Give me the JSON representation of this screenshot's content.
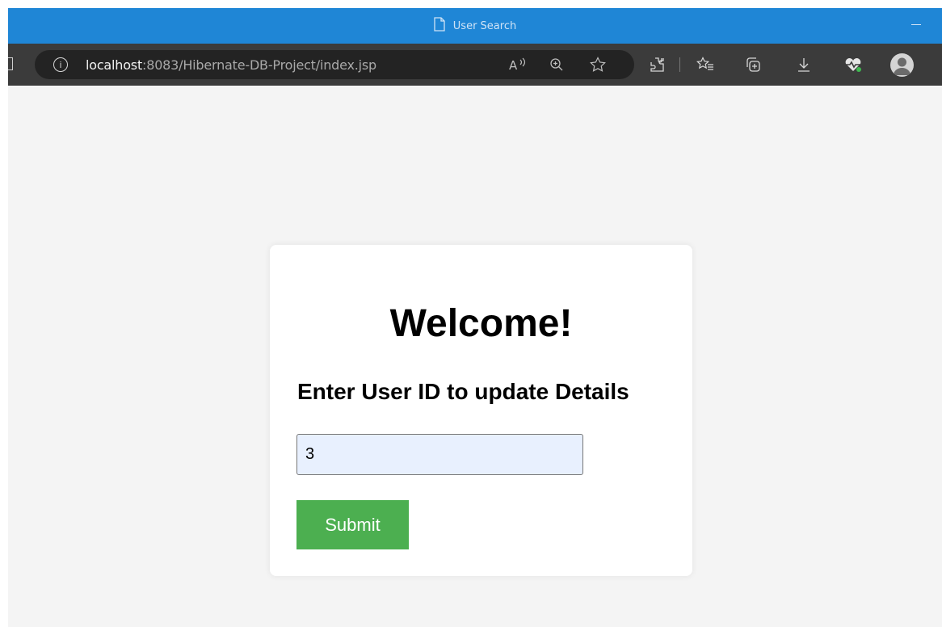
{
  "window": {
    "title": "User Search"
  },
  "address_bar": {
    "host": "localhost",
    "path": ":8083/Hibernate-DB-Project/index.jsp"
  },
  "toolbar": {
    "icons": [
      "home-icon",
      "info-icon",
      "read-aloud-icon",
      "zoom-icon",
      "favorite-star-icon",
      "extensions-icon",
      "favorites-icon",
      "collections-icon",
      "downloads-icon",
      "browser-essentials-icon",
      "profile-avatar"
    ]
  },
  "card": {
    "heading": "Welcome!",
    "subheading": "Enter User ID to update Details",
    "user_id_value": "3",
    "submit_label": "Submit"
  },
  "colors": {
    "titlebar": "#1f86d6",
    "toolbar": "#3b3b3b",
    "page_bg": "#f4f4f4",
    "submit_bg": "#4caf50",
    "input_bg": "#e8f0fe"
  }
}
